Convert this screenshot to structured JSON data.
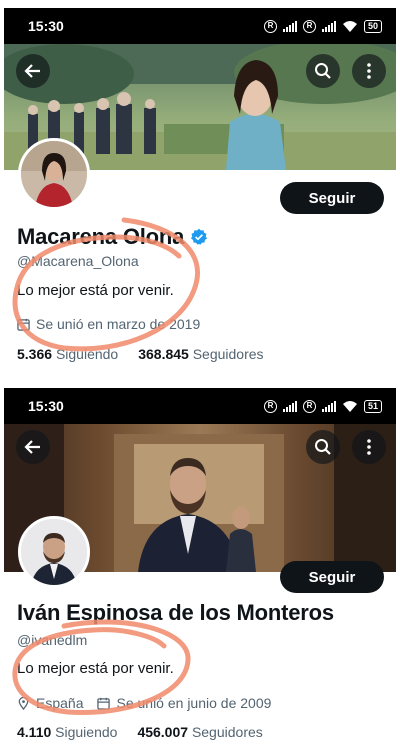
{
  "status_bar_top": {
    "time": "15:30",
    "battery": "50"
  },
  "status_bar_bottom": {
    "time": "15:30",
    "battery": "51"
  },
  "colors": {
    "follow_button": "#0f1419",
    "verified": "#1d9bf0",
    "annotation": "#f08a6a",
    "secondary_text": "#536471"
  },
  "profile1": {
    "name": "Macarena Olona",
    "handle": "@Macarena_Olona",
    "bio": "Lo mejor está por venir.",
    "joined": "Se unió en marzo de 2019",
    "following_count": "5.366",
    "following_label": "Siguiendo",
    "followers_count": "368.845",
    "followers_label": "Seguidores",
    "follow_label": "Seguir",
    "verified": true
  },
  "profile2": {
    "name": "Iván Espinosa de los Monteros",
    "handle": "@ivanedlm",
    "bio": "Lo mejor está por venir.",
    "location": "España",
    "joined": "Se unió en junio de 2009",
    "following_count": "4.110",
    "following_label": "Siguiendo",
    "followers_count": "456.007",
    "followers_label": "Seguidores",
    "follow_label": "Seguir"
  }
}
